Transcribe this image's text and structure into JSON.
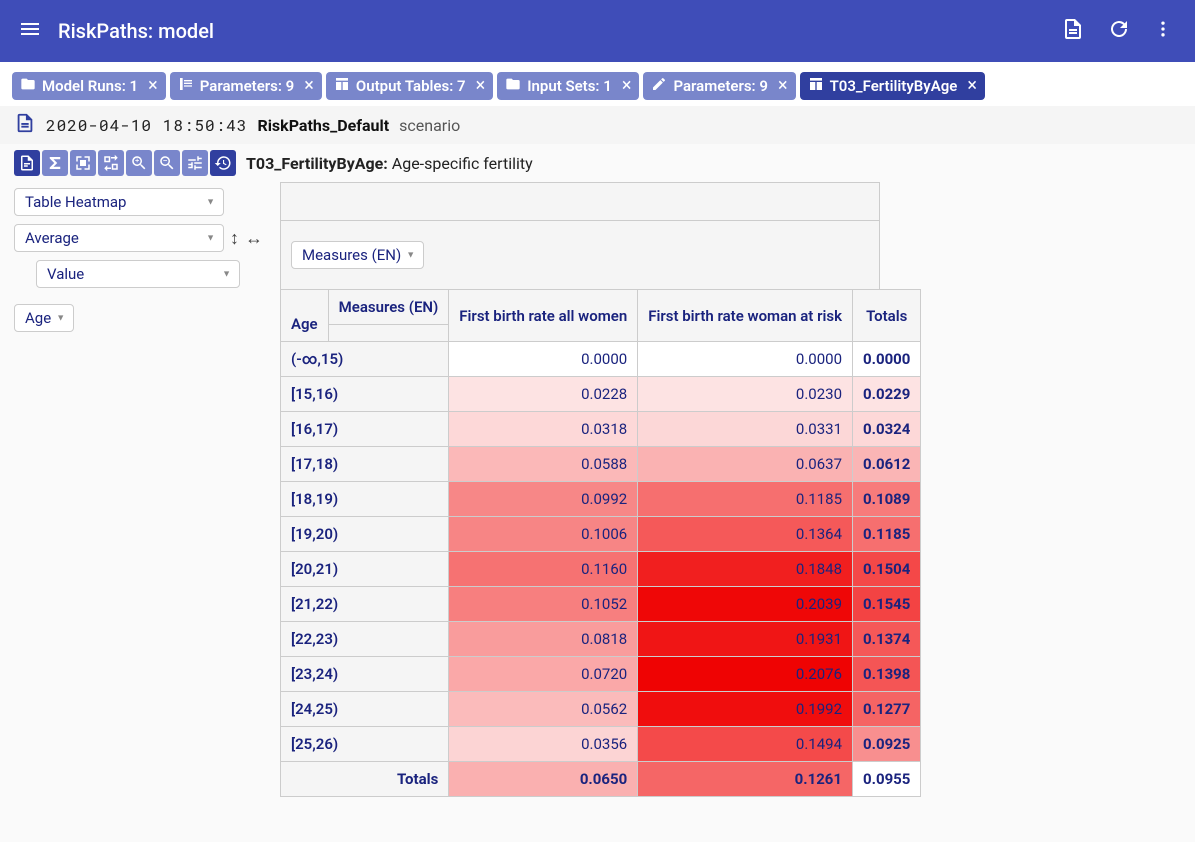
{
  "appbar": {
    "title": "RiskPaths: model"
  },
  "tabs": [
    {
      "icon": "folder",
      "label": "Model Runs: 1",
      "active": false,
      "closable": true
    },
    {
      "icon": "param",
      "label": "Parameters: 9",
      "active": false,
      "closable": true
    },
    {
      "icon": "table",
      "label": "Output Tables: 7",
      "active": false,
      "closable": true
    },
    {
      "icon": "folder",
      "label": "Input Sets: 1",
      "active": false,
      "closable": true
    },
    {
      "icon": "pencil",
      "label": "Parameters: 9",
      "active": false,
      "closable": true
    },
    {
      "icon": "table",
      "label": "T03_FertilityByAge",
      "active": true,
      "closable": true
    }
  ],
  "runinfo": {
    "timestamp": "2020-04-10 18:50:43",
    "name": "RiskPaths_Default",
    "scenario_label": "scenario"
  },
  "toolbar": {
    "code": "T03_FertilityByAge:",
    "desc": "Age-specific fertility"
  },
  "controls": {
    "view_mode": "Table Heatmap",
    "aggregation": "Average",
    "value_source": "Value",
    "col_dim": "Measures (EN)",
    "row_dim": "Age"
  },
  "chart_data": {
    "type": "heatmap",
    "title": "T03_FertilityByAge: Age-specific fertility",
    "row_dim": "Age",
    "col_dim": "Measures (EN)",
    "columns": [
      "First birth rate all women",
      "First birth rate woman at risk",
      "Totals"
    ],
    "rows": [
      {
        "label": "(-∞,15)",
        "values": [
          0.0,
          0.0,
          0.0
        ]
      },
      {
        "label": "[15,16)",
        "values": [
          0.0228,
          0.023,
          0.0229
        ]
      },
      {
        "label": "[16,17)",
        "values": [
          0.0318,
          0.0331,
          0.0324
        ]
      },
      {
        "label": "[17,18)",
        "values": [
          0.0588,
          0.0637,
          0.0612
        ]
      },
      {
        "label": "[18,19)",
        "values": [
          0.0992,
          0.1185,
          0.1089
        ]
      },
      {
        "label": "[19,20)",
        "values": [
          0.1006,
          0.1364,
          0.1185
        ]
      },
      {
        "label": "[20,21)",
        "values": [
          0.116,
          0.1848,
          0.1504
        ]
      },
      {
        "label": "[21,22)",
        "values": [
          0.1052,
          0.2039,
          0.1545
        ]
      },
      {
        "label": "[22,23)",
        "values": [
          0.0818,
          0.1931,
          0.1374
        ]
      },
      {
        "label": "[23,24)",
        "values": [
          0.072,
          0.2076,
          0.1398
        ]
      },
      {
        "label": "[24,25)",
        "values": [
          0.0562,
          0.1992,
          0.1277
        ]
      },
      {
        "label": "[25,26)",
        "values": [
          0.0356,
          0.1494,
          0.0925
        ]
      }
    ],
    "totals_row": {
      "label": "Totals",
      "values": [
        0.065,
        0.1261,
        0.0955
      ]
    },
    "color_scale": {
      "min_color": "#ffffff",
      "max_color": "#ef0000",
      "domain": [
        0.0,
        0.21
      ]
    }
  }
}
